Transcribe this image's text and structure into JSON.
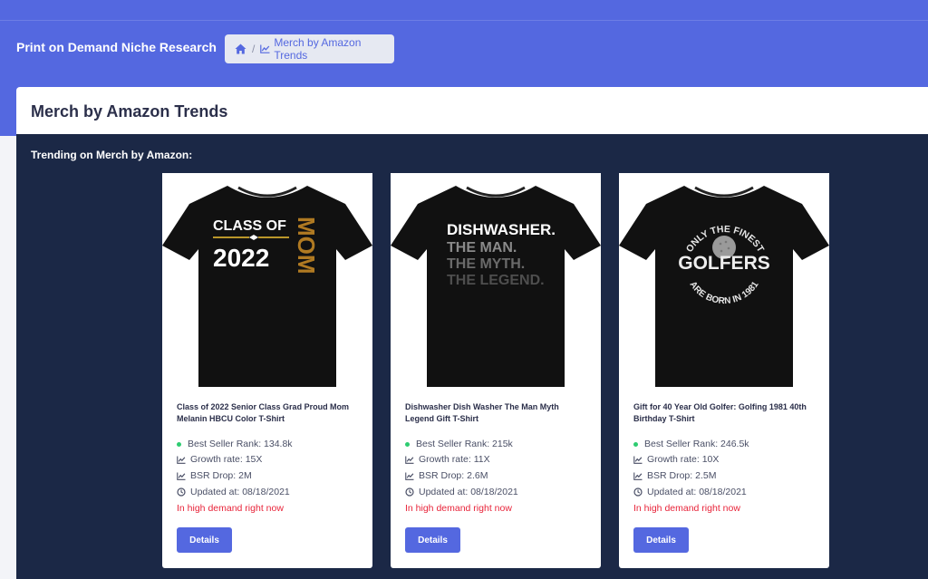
{
  "header": {
    "app_title": "Print on Demand Niche Research",
    "breadcrumb": {
      "home_icon": "home-icon",
      "separator": "/",
      "current_icon": "chart-line-icon",
      "current_label": "Merch by Amazon Trends"
    }
  },
  "page": {
    "title": "Merch by Amazon Trends",
    "section_title": "Trending on Merch by Amazon:"
  },
  "colors": {
    "header_bg": "#5468e0",
    "panel_bg": "#1b2846",
    "accent": "#5468e0",
    "demand_text": "#e8243a",
    "status_dot": "#2ecc71"
  },
  "products": [
    {
      "name": "Class of 2022 Senior Class Grad Proud Mom Melanin HBCU Color T-Shirt",
      "bsr": "Best Seller Rank: 134.8k",
      "growth": "Growth rate: 15X",
      "bsr_drop": "BSR Drop: 2M",
      "updated": "Updated at: 08/18/2021",
      "demand": "In high demand right now",
      "button": "Details",
      "shirt_text": [
        "CLASS OF",
        "2022",
        "MOM"
      ]
    },
    {
      "name": "Dishwasher Dish Washer The Man Myth Legend Gift T-Shirt",
      "bsr": "Best Seller Rank: 215k",
      "growth": "Growth rate: 11X",
      "bsr_drop": "BSR Drop: 2.6M",
      "updated": "Updated at: 08/18/2021",
      "demand": "In high demand right now",
      "button": "Details",
      "shirt_text": [
        "DISHWASHER.",
        "THE MAN.",
        "THE MYTH.",
        "THE LEGEND."
      ]
    },
    {
      "name": "Gift for 40 Year Old Golfer: Golfing 1981 40th Birthday T-Shirt",
      "bsr": "Best Seller Rank: 246.5k",
      "growth": "Growth rate: 10X",
      "bsr_drop": "BSR Drop: 2.5M",
      "updated": "Updated at: 08/18/2021",
      "demand": "In high demand right now",
      "button": "Details",
      "shirt_text": [
        "ONLY THE FINEST",
        "GOLFERS",
        "ARE BORN IN 1981"
      ]
    }
  ]
}
